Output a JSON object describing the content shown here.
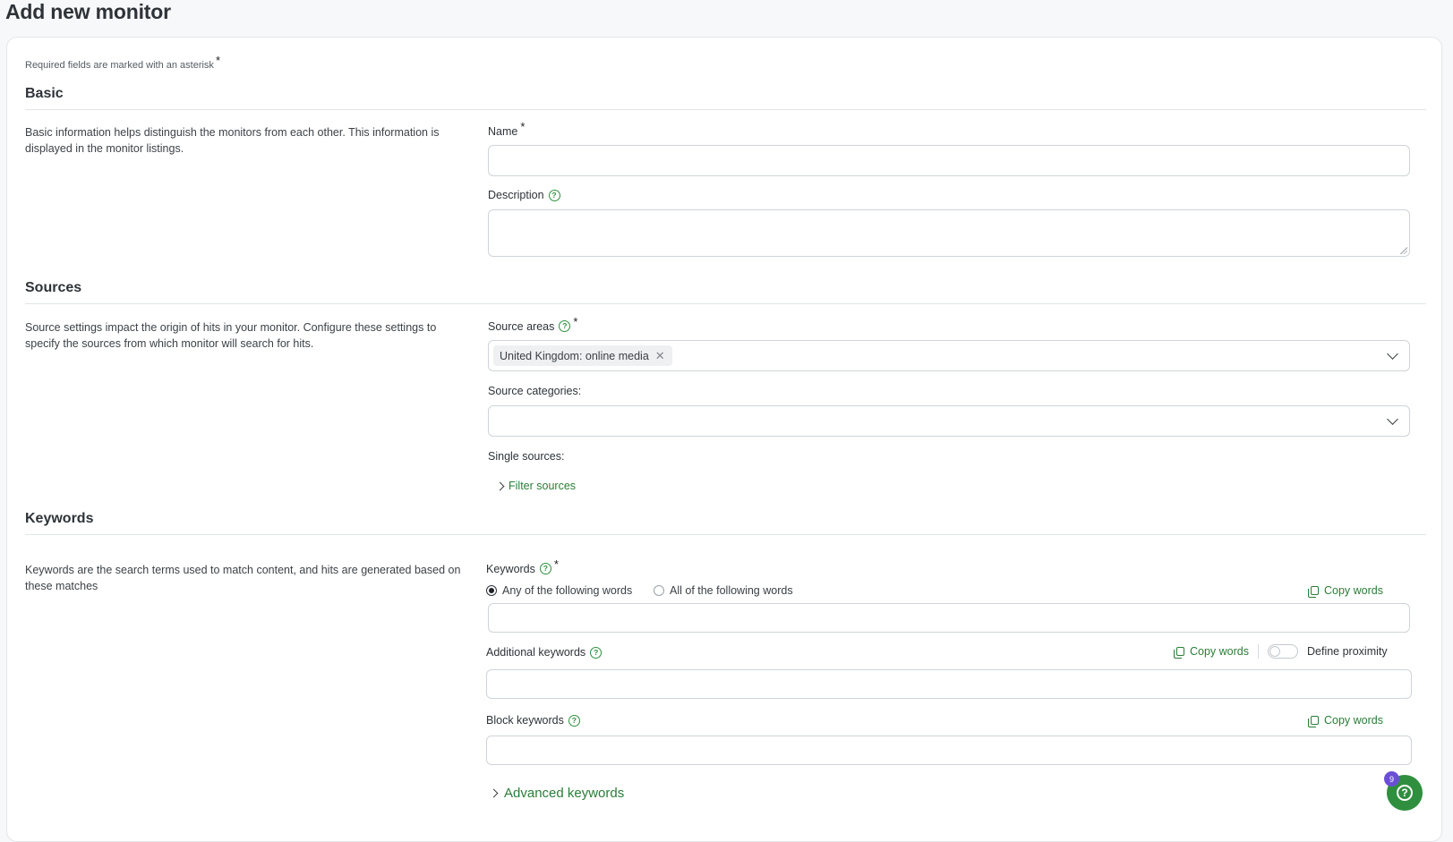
{
  "page": {
    "title": "Add new monitor"
  },
  "form": {
    "required_note": "Required fields are marked with an asterisk",
    "required_star": "*",
    "basic": {
      "title": "Basic",
      "description": "Basic information helps distinguish the monitors from each other. This information is displayed in the monitor listings.",
      "name_label": "Name",
      "name_value": "",
      "description_label": "Description",
      "description_value": ""
    },
    "sources": {
      "title": "Sources",
      "description": "Source settings impact the origin of hits in your monitor. Configure these settings to specify the sources from which monitor will search for hits.",
      "areas_label": "Source areas",
      "areas_selected": [
        "United Kingdom: online media"
      ],
      "categories_label": "Source categories:",
      "single_label": "Single sources:",
      "filter_link": "Filter sources"
    },
    "keywords": {
      "title": "Keywords",
      "description": "Keywords are the search terms used to match content, and hits are generated based on these matches",
      "keywords_label": "Keywords",
      "radio_any": "Any of the following words",
      "radio_all": "All of the following words",
      "selected_mode": "any",
      "copy_words": "Copy words",
      "additional_label": "Additional keywords",
      "define_proximity": "Define proximity",
      "proximity_enabled": false,
      "block_label": "Block keywords",
      "advanced_link": "Advanced keywords"
    }
  },
  "help_widget": {
    "badge_count": "9",
    "icon": "question-icon"
  },
  "colors": {
    "accent": "#2f8f3f",
    "link": "#2a7d37",
    "badge": "#6a4fd6"
  }
}
